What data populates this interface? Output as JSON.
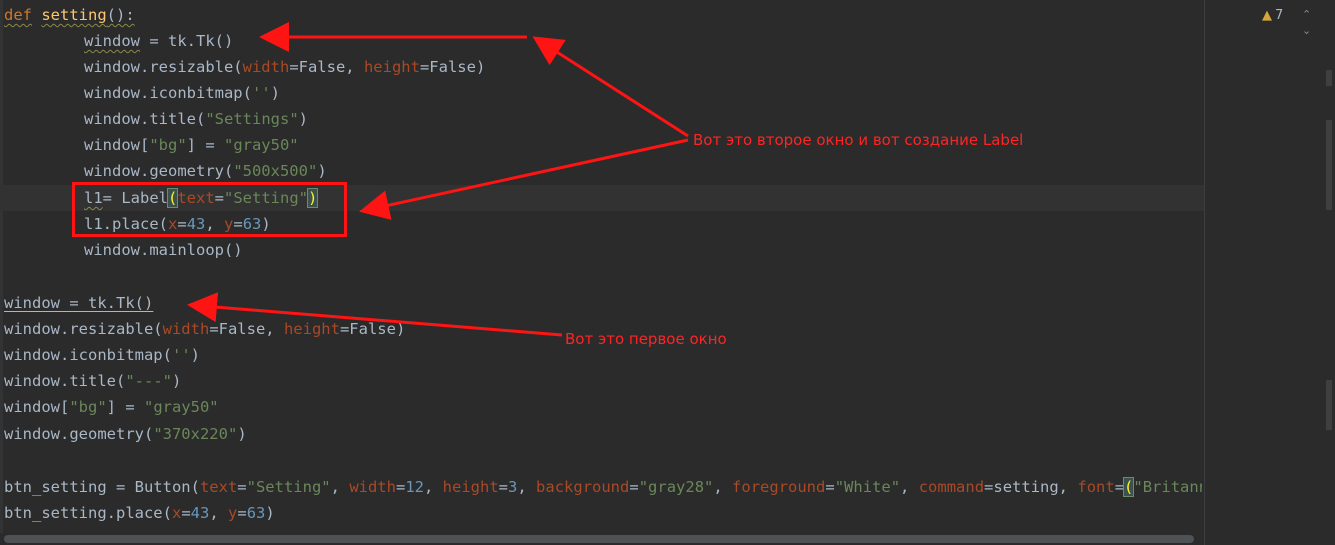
{
  "editor": {
    "code": {
      "l1": {
        "kw": "def",
        "name": "setting",
        "rest": "():"
      },
      "l2": {
        "var": "window",
        "rest": " = tk.Tk()"
      },
      "l3": {
        "pre": "window.resizable(",
        "p1": "width",
        "mid1": "=False, ",
        "p2": "height",
        "mid2": "=False)"
      },
      "l4": {
        "pre": "window.iconbitmap(",
        "s": "''",
        "post": ")"
      },
      "l5": {
        "pre": "window.title(",
        "s": "\"Settings\"",
        "post": ")"
      },
      "l6": {
        "pre": "window[",
        "s1": "\"bg\"",
        "mid": "] = ",
        "s2": "\"gray50\""
      },
      "l7": {
        "pre": "window.geometry(",
        "s": "\"500x500\"",
        "post": ")"
      },
      "l8": {
        "var": "l1",
        "eq": "= Label",
        "open": "(",
        "p": "text",
        "mid": "=",
        "s": "\"Setting\"",
        "close": ")"
      },
      "l9": {
        "pre": "l1.place(",
        "p1": "x",
        "mid1": "=",
        "n1": "43",
        "mid2": ", ",
        "p2": "y",
        "mid3": "=",
        "n2": "63",
        "post": ")"
      },
      "l10": {
        "text": "window.mainloop()"
      },
      "l12": {
        "var": "window",
        "rest": " = tk.Tk()"
      },
      "l13": {
        "pre": "window.resizable(",
        "p1": "width",
        "mid1": "=False, ",
        "p2": "height",
        "mid2": "=False)"
      },
      "l14": {
        "pre": "window.iconbitmap(",
        "s": "''",
        "post": ")"
      },
      "l15": {
        "pre": "window.title(",
        "s": "\"---\"",
        "post": ")"
      },
      "l16": {
        "pre": "window[",
        "s1": "\"bg\"",
        "mid": "] = ",
        "s2": "\"gray50\""
      },
      "l17": {
        "pre": "window.geometry(",
        "s": "\"370x220\"",
        "post": ")"
      },
      "l19": {
        "pre": "btn_setting = Button(",
        "p1": "text",
        "e1": "=",
        "s1": "\"Setting\"",
        "c1": ", ",
        "p2": "width",
        "e2": "=",
        "n2": "12",
        "c2": ", ",
        "p3": "height",
        "e3": "=",
        "n3": "3",
        "c3": ", ",
        "p4": "background",
        "e4": "=",
        "s4": "\"gray28\"",
        "c4": ", ",
        "p5": "foreground",
        "e5": "=",
        "s5": "\"White\"",
        "c5": ", ",
        "p6": "command",
        "e6": "=setting, ",
        "p7": "font",
        "e7": "=",
        "open": "(",
        "s7": "\"Britannic B"
      },
      "l20": {
        "pre": "btn_setting.place(",
        "p1": "x",
        "mid1": "=",
        "n1": "43",
        "mid2": ", ",
        "p2": "y",
        "mid3": "=",
        "n2": "63",
        "post": ")"
      }
    },
    "inspection": {
      "count": "7"
    },
    "colors": {
      "annotation": "#ff1414",
      "background": "#2b2b2b"
    }
  },
  "annotations": {
    "second_window": "Вот это второе окно и вот создание Label",
    "first_window": "Вот это первое окно"
  }
}
